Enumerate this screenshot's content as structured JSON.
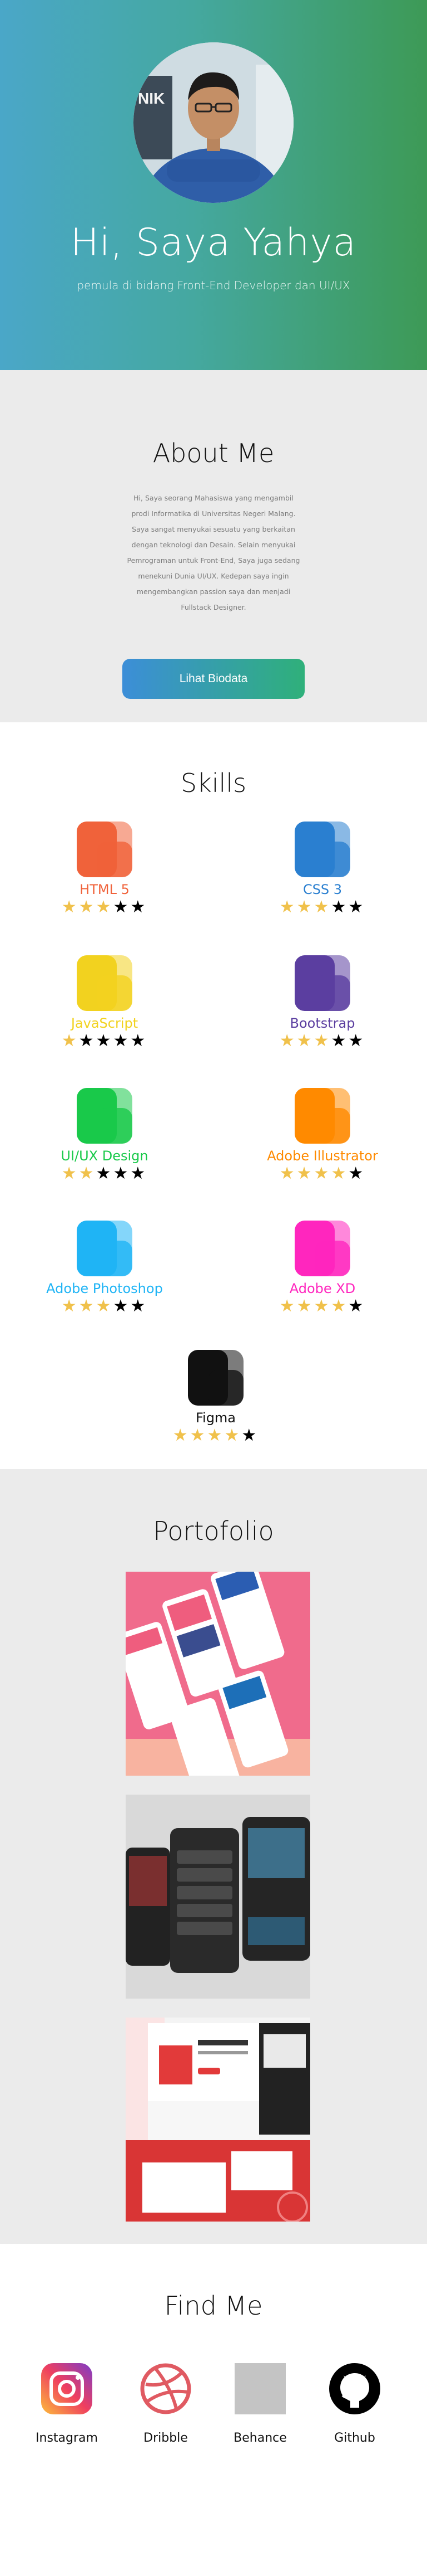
{
  "hero": {
    "name": "Hi, Saya Yahya",
    "subtitle": "pemula di bidang Front-End Developer dan UI/UX"
  },
  "about": {
    "title": "About Me",
    "paragraph": "Hi, Saya seorang Mahasiswa yang mengambil prodi Informatika di Universitas Negeri Malang. Saya sangat menyukai sesuatu yang berkaitan dengan teknologi dan Desain. Selain menyukai Pemrograman untuk Front-End, Saya juga sedang menekuni Dunia UI/UX. Kedepan saya ingin mengembangkan passion saya dan menjadi Fullstack Designer.",
    "button_label": "Lihat Biodata"
  },
  "skills": {
    "title": "Skills",
    "items": [
      {
        "name": "HTML 5",
        "rating": 3,
        "color": "#f0623a",
        "icon": "html5-icon"
      },
      {
        "name": "CSS 3",
        "rating": 3,
        "color": "#2a7fd0",
        "icon": "css3-icon"
      },
      {
        "name": "JavaScript",
        "rating": 1,
        "color": "#f2d21f",
        "icon": "javascript-icon"
      },
      {
        "name": "Bootstrap",
        "rating": 3,
        "color": "#5b3ea0",
        "icon": "bootstrap-icon"
      },
      {
        "name": "UI/UX Design",
        "rating": 2,
        "color": "#19c94a",
        "icon": "uiux-icon"
      },
      {
        "name": "Adobe Illustrator",
        "rating": 4,
        "color": "#ff8a00",
        "icon": "illustrator-icon"
      },
      {
        "name": "Adobe Photoshop",
        "rating": 3,
        "color": "#1fb4f5",
        "icon": "photoshop-icon"
      },
      {
        "name": "Adobe XD",
        "rating": 4,
        "color": "#ff26be",
        "icon": "xd-icon"
      },
      {
        "name": "Figma",
        "rating": 4,
        "color": "#111111",
        "icon": "figma-icon"
      }
    ]
  },
  "portfolio": {
    "title": "Portofolio"
  },
  "findme": {
    "title": "Find Me",
    "links": [
      {
        "label": "Instagram",
        "icon": "instagram-icon"
      },
      {
        "label": "Dribble",
        "icon": "dribbble-icon"
      },
      {
        "label": "Behance",
        "icon": "behance-icon"
      },
      {
        "label": "Github",
        "icon": "github-icon"
      }
    ]
  }
}
